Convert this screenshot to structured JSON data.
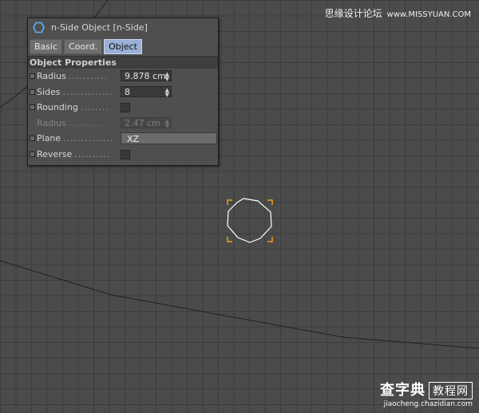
{
  "watermark_top": {
    "text": "思缘设计论坛",
    "url": "www.MISSYUAN.COM"
  },
  "watermark_bottom": {
    "line1": "查字典",
    "box": "教程网",
    "line2": "jiaocheng.chazidian.com"
  },
  "panel": {
    "icon": "n-side-hexagon-icon",
    "title": "n-Side Object [n-Side]",
    "tabs": [
      {
        "label": "Basic",
        "active": false
      },
      {
        "label": "Coord.",
        "active": false
      },
      {
        "label": "Object",
        "active": true
      }
    ],
    "section": "Object Properties",
    "fields": {
      "radius": {
        "label": "Radius",
        "dots": "...........",
        "value": "9.878 cm"
      },
      "sides": {
        "label": "Sides",
        "dots": "..............",
        "value": "8"
      },
      "rounding": {
        "label": "Rounding",
        "dots": "........",
        "checked": false
      },
      "round_radius": {
        "label": "Radius",
        "dots": "...........",
        "value": "2.47 cm",
        "disabled": true
      },
      "plane": {
        "label": "Plane",
        "dots": "..............",
        "value": "XZ"
      },
      "reverse": {
        "label": "Reverse",
        "dots": "..........",
        "checked": false
      }
    }
  },
  "viewport": {
    "grid_color": "#3c3c3c",
    "background": "#4b4b4b",
    "selection_color": "#f0a020",
    "shape": "octagon"
  }
}
